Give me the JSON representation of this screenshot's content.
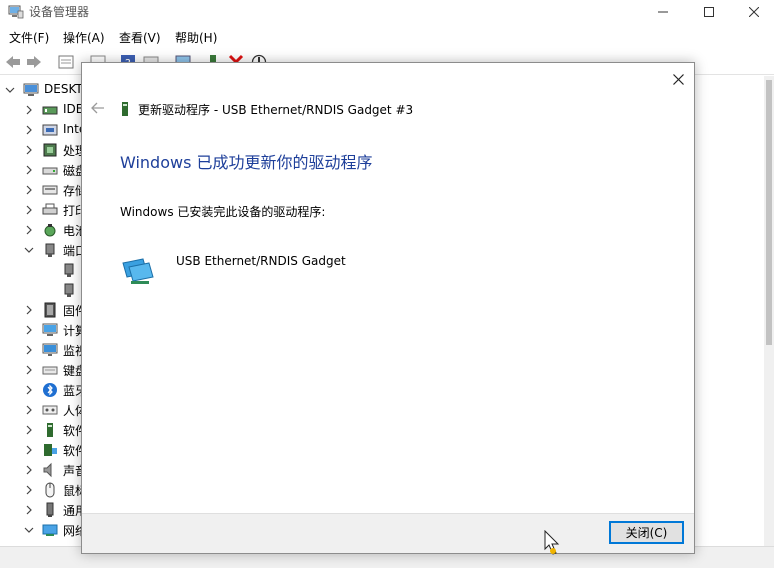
{
  "window": {
    "title": "设备管理器",
    "min_glyph": "—",
    "max_glyph": "☐",
    "close_glyph": "✕"
  },
  "menu": {
    "file": "文件(F)",
    "action": "操作(A)",
    "view": "查看(V)",
    "help": "帮助(H)"
  },
  "tree": {
    "root": "DESKT",
    "items": [
      {
        "label": "IDE",
        "icon": "ide-controller-icon"
      },
      {
        "label": "Inte",
        "icon": "intel-device-icon"
      },
      {
        "label": "处理",
        "icon": "processor-icon"
      },
      {
        "label": "磁盘",
        "icon": "disk-drive-icon"
      },
      {
        "label": "存储",
        "icon": "storage-controller-icon"
      },
      {
        "label": "打印",
        "icon": "printer-icon"
      },
      {
        "label": "电池",
        "icon": "battery-icon"
      },
      {
        "label": "端口",
        "icon": "port-icon"
      },
      {
        "label": "",
        "icon": "port-device-icon"
      },
      {
        "label": "",
        "icon": "port-device-icon"
      },
      {
        "label": "固件",
        "icon": "firmware-icon"
      },
      {
        "label": "计算",
        "icon": "computer-icon"
      },
      {
        "label": "监视",
        "icon": "monitor-icon"
      },
      {
        "label": "键盘",
        "icon": "keyboard-icon"
      },
      {
        "label": "蓝牙",
        "icon": "bluetooth-icon"
      },
      {
        "label": "人体",
        "icon": "human-interface-icon"
      },
      {
        "label": "软件",
        "icon": "software-component-icon"
      },
      {
        "label": "软件",
        "icon": "software-device-icon"
      },
      {
        "label": "声音",
        "icon": "sound-icon"
      },
      {
        "label": "鼠标",
        "icon": "mouse-icon"
      },
      {
        "label": "通用",
        "icon": "usb-controller-icon"
      },
      {
        "label": "网络",
        "icon": "network-adapter-icon"
      }
    ]
  },
  "dialog": {
    "title": "更新驱动程序 - USB Ethernet/RNDIS Gadget #3",
    "heading": "Windows 已成功更新你的驱动程序",
    "description": "Windows 已安装完此设备的驱动程序:",
    "device_name": "USB Ethernet/RNDIS Gadget",
    "close_button": "关闭(C)",
    "close_glyph": "✕"
  },
  "colors": {
    "heading": "#1e3f9a",
    "focus_border": "#0078d7",
    "footer": "#f0f0f0"
  }
}
